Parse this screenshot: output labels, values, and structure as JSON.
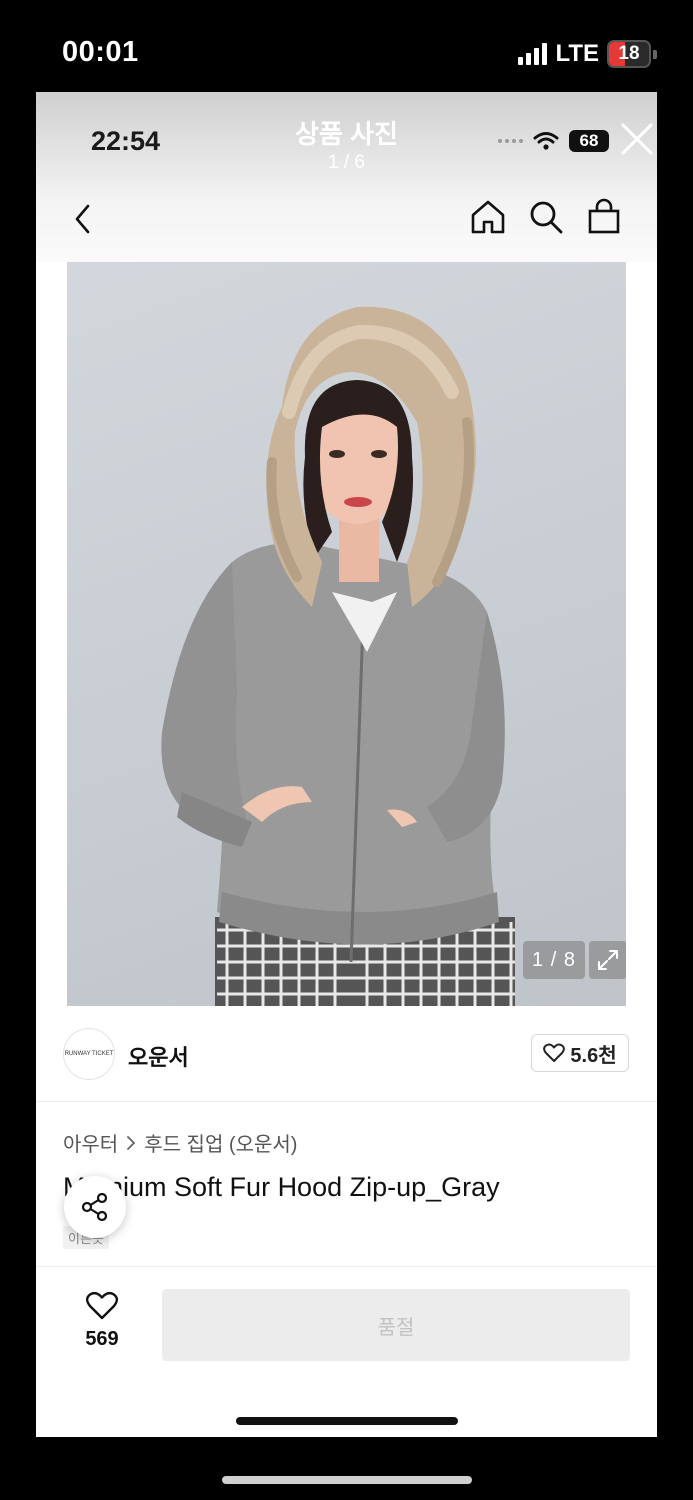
{
  "outer_status": {
    "time": "00:01",
    "network": "LTE",
    "battery": "18"
  },
  "viewer": {
    "inner_time": "22:54",
    "title": "상품 사진",
    "counter": "1 / 6",
    "inner_battery": "68"
  },
  "photo": {
    "counter": "1 / 8"
  },
  "seller": {
    "logo_text": "RUNWAY TICKET",
    "name": "오운서",
    "likes": "5.6천"
  },
  "product": {
    "breadcrumb": [
      "아우터",
      "후드 집업 (오운서)"
    ],
    "title": "M   nnium Soft Fur Hood Zip-up_Gray",
    "tag": "이른옷"
  },
  "bottom": {
    "wish_count": "569",
    "soldout_label": "품절"
  },
  "icons": {
    "back": "chevron-left-icon",
    "home": "home-icon",
    "search": "search-icon",
    "cart": "shopping-bag-icon",
    "close": "close-icon",
    "expand": "expand-icon",
    "share": "share-icon",
    "heart": "heart-icon"
  },
  "colors": {
    "battery_low": "#e53935",
    "soldout_bg": "#ececec"
  }
}
